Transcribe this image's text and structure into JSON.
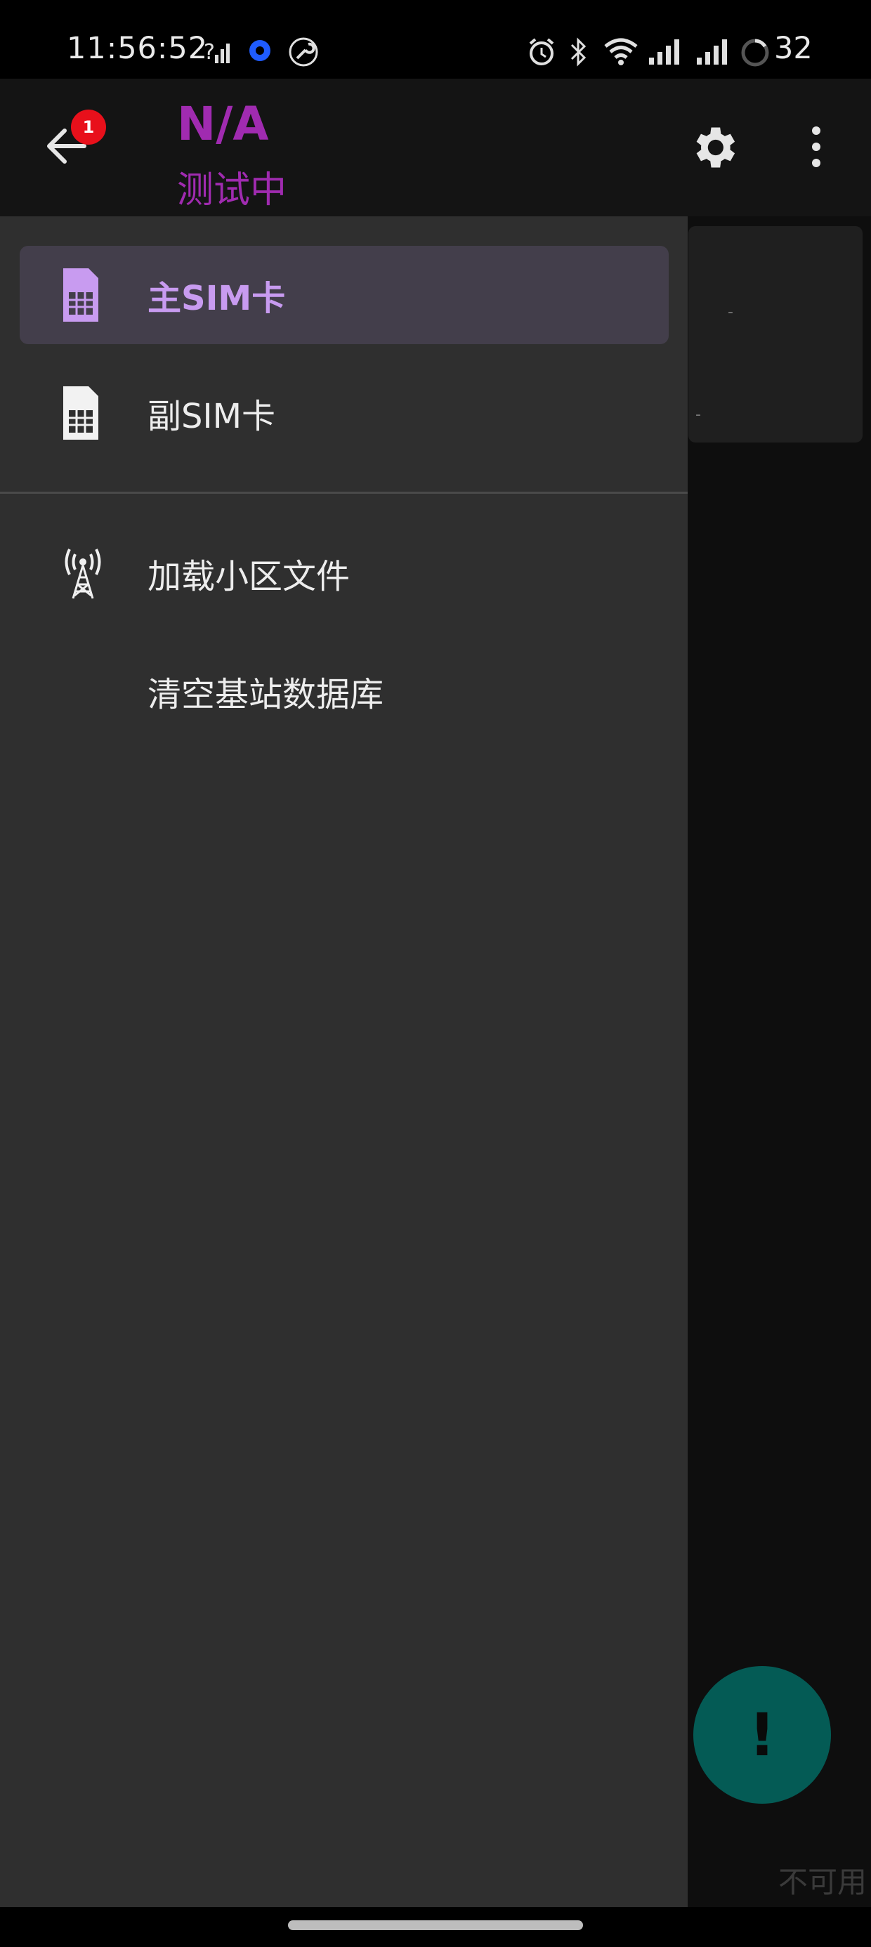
{
  "status_bar": {
    "time": "11:56:52",
    "battery": "32",
    "icons": [
      "signal-question-icon",
      "vpn-dot-icon",
      "wrench-icon",
      "alarm-icon",
      "bluetooth-icon",
      "wifi-icon",
      "cell-signal-icon",
      "cell-signal-icon",
      "battery-ring-icon"
    ]
  },
  "app_bar": {
    "title": "N/A",
    "subtitle": "测试中",
    "badge_count": "1",
    "title_color": "#a02bb0"
  },
  "drawer": {
    "items": [
      {
        "label": "主SIM卡",
        "icon": "sim-card-icon",
        "selected": true
      },
      {
        "label": "副SIM卡",
        "icon": "sim-card-icon",
        "selected": false
      }
    ],
    "actions": [
      {
        "label": "加载小区文件",
        "icon": "cell-tower-icon"
      },
      {
        "label": "清空基站数据库",
        "icon": ""
      }
    ],
    "selected_color": "#c89bf0"
  },
  "background": {
    "card_values": [
      "-",
      "-"
    ],
    "fab_symbol": "!",
    "fab_color": "#045b55",
    "status_text": "不可用"
  }
}
